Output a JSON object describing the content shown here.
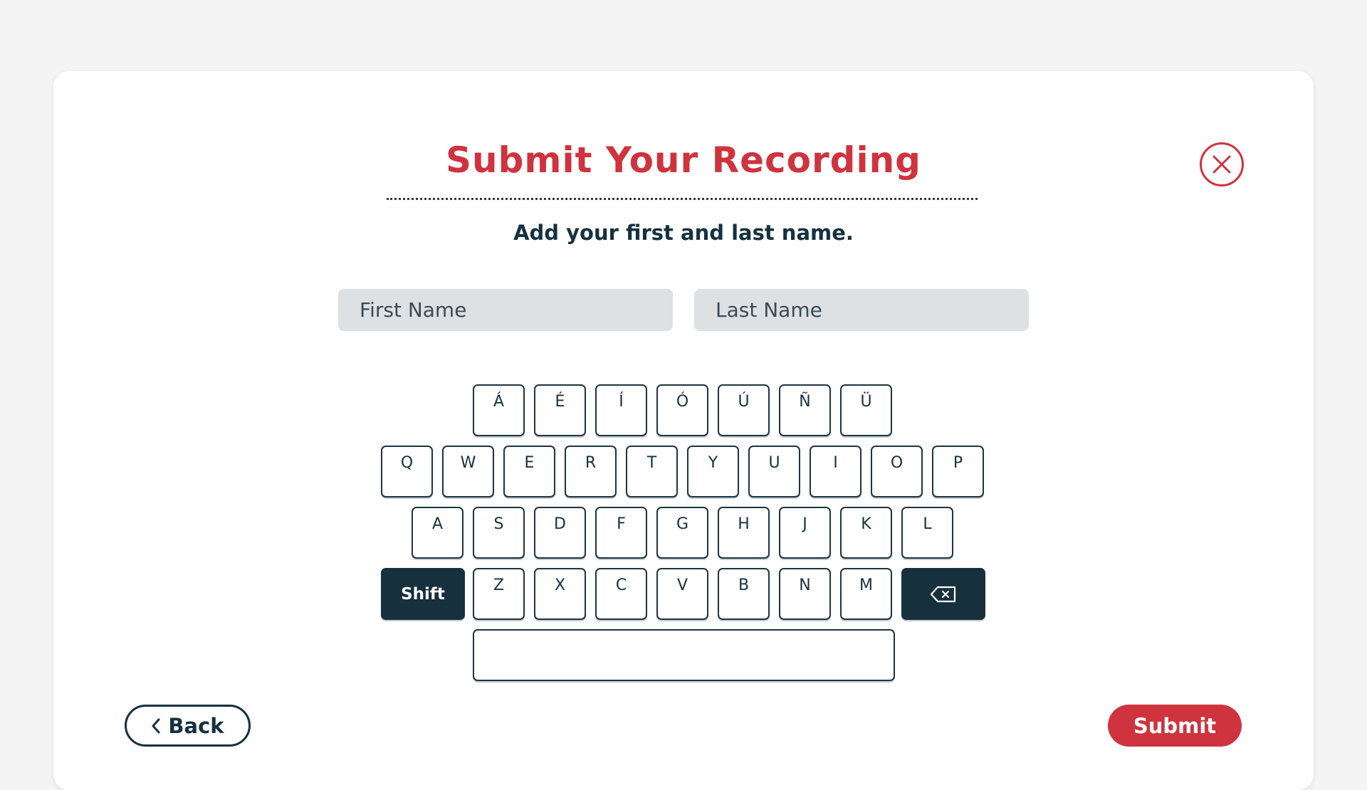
{
  "dialog": {
    "title": "Submit Your Recording",
    "subtitle": "Add your first and last name.",
    "close_icon": "close-circle-icon"
  },
  "form": {
    "first_name": {
      "value": "",
      "placeholder": "First Name"
    },
    "last_name": {
      "value": "",
      "placeholder": "Last Name"
    }
  },
  "keyboard": {
    "row_accents": [
      "Á",
      "É",
      "Í",
      "Ó",
      "Ú",
      "Ñ",
      "Ü"
    ],
    "row_1": [
      "Q",
      "W",
      "E",
      "R",
      "T",
      "Y",
      "U",
      "I",
      "O",
      "P"
    ],
    "row_2": [
      "A",
      "S",
      "D",
      "F",
      "G",
      "H",
      "J",
      "K",
      "L"
    ],
    "row_3": [
      "Z",
      "X",
      "C",
      "V",
      "B",
      "N",
      "M"
    ],
    "shift_label": "Shift",
    "backspace_icon": "backspace-icon",
    "space_label": ""
  },
  "footer": {
    "back_label": "Back",
    "back_icon": "chevron-left-icon",
    "submit_label": "Submit"
  },
  "colors": {
    "accent": "#cf333d",
    "navy": "#16313f",
    "input_bg": "#dde1e4"
  }
}
